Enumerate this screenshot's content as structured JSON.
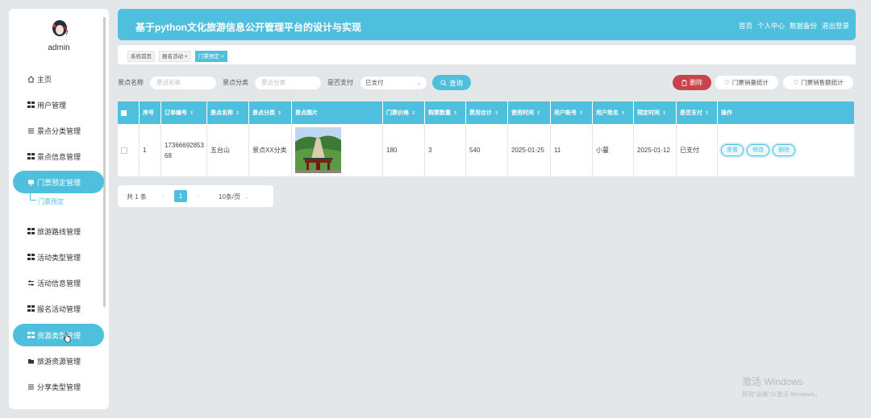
{
  "sidebar": {
    "username": "admin",
    "items": [
      {
        "label": "主页",
        "icon": "home-icon"
      },
      {
        "label": "用户管理",
        "icon": "grid-icon"
      },
      {
        "label": "景点分类管理",
        "icon": "list-icon"
      },
      {
        "label": "景点信息管理",
        "icon": "grid-icon"
      },
      {
        "label": "门票预定管理",
        "icon": "monitor-icon"
      },
      {
        "label": "旅游路线管理",
        "icon": "grid-icon"
      },
      {
        "label": "活动类型管理",
        "icon": "grid-icon"
      },
      {
        "label": "活动信息管理",
        "icon": "sliders-icon"
      },
      {
        "label": "报名活动管理",
        "icon": "grid-icon"
      },
      {
        "label": "资源类型管理",
        "icon": "grid-icon"
      },
      {
        "label": "旅游资源管理",
        "icon": "folder-icon"
      },
      {
        "label": "分享类型管理",
        "icon": "list-icon"
      }
    ],
    "sub_item": "门票预定"
  },
  "header": {
    "title": "基于python文化旅游信息公开管理平台的设计与实现",
    "links": [
      "首页",
      "个人中心",
      "数据备份",
      "退出登录"
    ]
  },
  "tabs": [
    "系统首页",
    "报名活动",
    "门票预定"
  ],
  "search": {
    "name_label": "景点名称",
    "name_placeholder": "景点名称",
    "category_label": "景点分类",
    "category_placeholder": "景点分类",
    "paid_label": "是否支付",
    "paid_value": "已支付",
    "query_button": "查询",
    "delete_button": "删除",
    "stat1_button": "门票销量统计",
    "stat2_button": "门票销售额统计"
  },
  "table": {
    "headers": [
      "序号",
      "订单编号",
      "景点名称",
      "景点分类",
      "景点图片",
      "门票价格",
      "购票数量",
      "费用合计",
      "使用时间",
      "用户账号",
      "用户姓名",
      "预定时间",
      "是否支付",
      "操作"
    ],
    "rows": [
      {
        "index": "1",
        "order_no": "1736669285368",
        "scenic_name": "五台山",
        "category": "景点XX分类",
        "price": "180",
        "quantity": "3",
        "total": "540",
        "use_time": "2025-01-25",
        "account": "11",
        "user_name": "小蔓",
        "booking_time": "2025-01-12",
        "paid": "已支付",
        "ops": [
          "查看",
          "修改",
          "删除"
        ]
      }
    ]
  },
  "pager": {
    "total": "共 1 条",
    "current_page": "1",
    "page_size": "10条/页"
  },
  "watermark": {
    "line1": "激活 Windows",
    "line2": "转到\"设置\"以激活 Windows。"
  }
}
